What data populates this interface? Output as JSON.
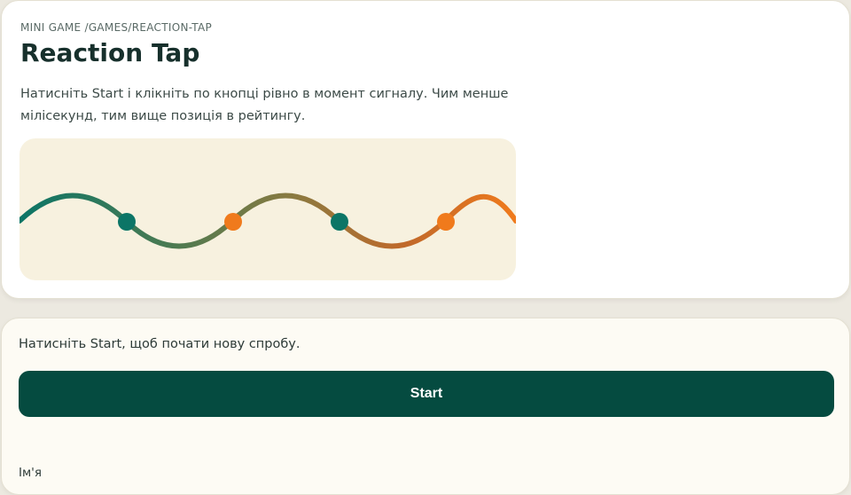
{
  "header": {
    "breadcrumb": "MINI GAME /GAMES/REACTION-TAP",
    "title": "Reaction Tap",
    "description": "Натисніть Start і клікніть по кнопці рівно в момент сигналу. Чим менше мілісекунд, тим вище позиція в рейтингу."
  },
  "illustration": {
    "wave_gradient": [
      "#0c7566",
      "#4a7a52",
      "#8a7a40",
      "#c1692a",
      "#f07a1c"
    ],
    "dot_colors": [
      "#0c7566",
      "#f07a1c",
      "#0c7566",
      "#f07a1c"
    ],
    "background": "#f7f1df"
  },
  "game": {
    "status_text": "Натисніть Start, щоб почати нову спробу.",
    "start_label": "Start",
    "name_label": "Ім'я"
  },
  "colors": {
    "accent": "#054b40",
    "title": "#17302c"
  }
}
